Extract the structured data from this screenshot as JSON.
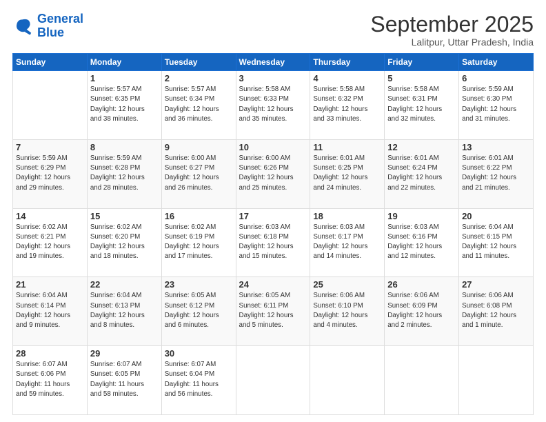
{
  "logo": {
    "line1": "General",
    "line2": "Blue"
  },
  "title": "September 2025",
  "subtitle": "Lalitpur, Uttar Pradesh, India",
  "weekdays": [
    "Sunday",
    "Monday",
    "Tuesday",
    "Wednesday",
    "Thursday",
    "Friday",
    "Saturday"
  ],
  "weeks": [
    [
      {
        "day": "",
        "info": ""
      },
      {
        "day": "1",
        "info": "Sunrise: 5:57 AM\nSunset: 6:35 PM\nDaylight: 12 hours\nand 38 minutes."
      },
      {
        "day": "2",
        "info": "Sunrise: 5:57 AM\nSunset: 6:34 PM\nDaylight: 12 hours\nand 36 minutes."
      },
      {
        "day": "3",
        "info": "Sunrise: 5:58 AM\nSunset: 6:33 PM\nDaylight: 12 hours\nand 35 minutes."
      },
      {
        "day": "4",
        "info": "Sunrise: 5:58 AM\nSunset: 6:32 PM\nDaylight: 12 hours\nand 33 minutes."
      },
      {
        "day": "5",
        "info": "Sunrise: 5:58 AM\nSunset: 6:31 PM\nDaylight: 12 hours\nand 32 minutes."
      },
      {
        "day": "6",
        "info": "Sunrise: 5:59 AM\nSunset: 6:30 PM\nDaylight: 12 hours\nand 31 minutes."
      }
    ],
    [
      {
        "day": "7",
        "info": "Sunrise: 5:59 AM\nSunset: 6:29 PM\nDaylight: 12 hours\nand 29 minutes."
      },
      {
        "day": "8",
        "info": "Sunrise: 5:59 AM\nSunset: 6:28 PM\nDaylight: 12 hours\nand 28 minutes."
      },
      {
        "day": "9",
        "info": "Sunrise: 6:00 AM\nSunset: 6:27 PM\nDaylight: 12 hours\nand 26 minutes."
      },
      {
        "day": "10",
        "info": "Sunrise: 6:00 AM\nSunset: 6:26 PM\nDaylight: 12 hours\nand 25 minutes."
      },
      {
        "day": "11",
        "info": "Sunrise: 6:01 AM\nSunset: 6:25 PM\nDaylight: 12 hours\nand 24 minutes."
      },
      {
        "day": "12",
        "info": "Sunrise: 6:01 AM\nSunset: 6:24 PM\nDaylight: 12 hours\nand 22 minutes."
      },
      {
        "day": "13",
        "info": "Sunrise: 6:01 AM\nSunset: 6:22 PM\nDaylight: 12 hours\nand 21 minutes."
      }
    ],
    [
      {
        "day": "14",
        "info": "Sunrise: 6:02 AM\nSunset: 6:21 PM\nDaylight: 12 hours\nand 19 minutes."
      },
      {
        "day": "15",
        "info": "Sunrise: 6:02 AM\nSunset: 6:20 PM\nDaylight: 12 hours\nand 18 minutes."
      },
      {
        "day": "16",
        "info": "Sunrise: 6:02 AM\nSunset: 6:19 PM\nDaylight: 12 hours\nand 17 minutes."
      },
      {
        "day": "17",
        "info": "Sunrise: 6:03 AM\nSunset: 6:18 PM\nDaylight: 12 hours\nand 15 minutes."
      },
      {
        "day": "18",
        "info": "Sunrise: 6:03 AM\nSunset: 6:17 PM\nDaylight: 12 hours\nand 14 minutes."
      },
      {
        "day": "19",
        "info": "Sunrise: 6:03 AM\nSunset: 6:16 PM\nDaylight: 12 hours\nand 12 minutes."
      },
      {
        "day": "20",
        "info": "Sunrise: 6:04 AM\nSunset: 6:15 PM\nDaylight: 12 hours\nand 11 minutes."
      }
    ],
    [
      {
        "day": "21",
        "info": "Sunrise: 6:04 AM\nSunset: 6:14 PM\nDaylight: 12 hours\nand 9 minutes."
      },
      {
        "day": "22",
        "info": "Sunrise: 6:04 AM\nSunset: 6:13 PM\nDaylight: 12 hours\nand 8 minutes."
      },
      {
        "day": "23",
        "info": "Sunrise: 6:05 AM\nSunset: 6:12 PM\nDaylight: 12 hours\nand 6 minutes."
      },
      {
        "day": "24",
        "info": "Sunrise: 6:05 AM\nSunset: 6:11 PM\nDaylight: 12 hours\nand 5 minutes."
      },
      {
        "day": "25",
        "info": "Sunrise: 6:06 AM\nSunset: 6:10 PM\nDaylight: 12 hours\nand 4 minutes."
      },
      {
        "day": "26",
        "info": "Sunrise: 6:06 AM\nSunset: 6:09 PM\nDaylight: 12 hours\nand 2 minutes."
      },
      {
        "day": "27",
        "info": "Sunrise: 6:06 AM\nSunset: 6:08 PM\nDaylight: 12 hours\nand 1 minute."
      }
    ],
    [
      {
        "day": "28",
        "info": "Sunrise: 6:07 AM\nSunset: 6:06 PM\nDaylight: 11 hours\nand 59 minutes."
      },
      {
        "day": "29",
        "info": "Sunrise: 6:07 AM\nSunset: 6:05 PM\nDaylight: 11 hours\nand 58 minutes."
      },
      {
        "day": "30",
        "info": "Sunrise: 6:07 AM\nSunset: 6:04 PM\nDaylight: 11 hours\nand 56 minutes."
      },
      {
        "day": "",
        "info": ""
      },
      {
        "day": "",
        "info": ""
      },
      {
        "day": "",
        "info": ""
      },
      {
        "day": "",
        "info": ""
      }
    ]
  ]
}
